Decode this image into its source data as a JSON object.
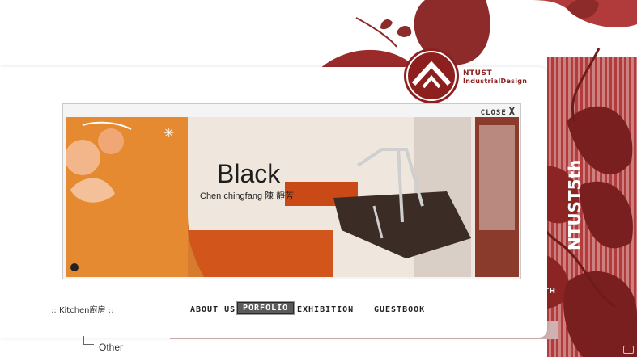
{
  "brand": {
    "line1": "NTUST",
    "line2": "IndustrialDesign"
  },
  "viewer": {
    "close_label": "CLOSE",
    "close_glyph": "X",
    "title": "Black",
    "subtitle": "Chen chingfang 陳 靜芳",
    "description": "......"
  },
  "side": {
    "label": "NTUST5TH",
    "vertical": "NTUST5th"
  },
  "nav": {
    "items": [
      {
        "label": "ABOUT US",
        "active": false
      },
      {
        "label": "PORFOLIO",
        "active": true
      },
      {
        "label": "EXHIBITION",
        "active": false
      },
      {
        "label": "GUESTBOOK",
        "active": false
      }
    ]
  },
  "breadcrumb": {
    "prefix": "::",
    "label": "Kitchen廚房",
    "suffix": "::"
  },
  "subnav": {
    "item": "Other"
  },
  "colors": {
    "brand_red": "#8d1f1f",
    "accent_orange": "#e8832a",
    "light_red": "#c43a3a"
  }
}
